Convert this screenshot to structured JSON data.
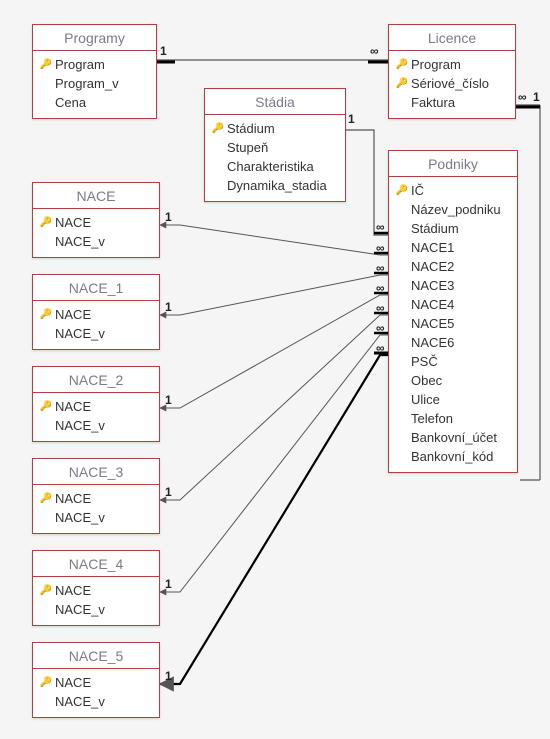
{
  "tables": {
    "programy": {
      "title": "Programy",
      "fields": [
        {
          "name": "Program",
          "pk": true
        },
        {
          "name": "Program_v",
          "pk": false
        },
        {
          "name": "Cena",
          "pk": false
        }
      ]
    },
    "licence": {
      "title": "Licence",
      "fields": [
        {
          "name": "Program",
          "pk": true
        },
        {
          "name": "Sériové_číslo",
          "pk": true
        },
        {
          "name": "Faktura",
          "pk": false
        }
      ]
    },
    "stadia": {
      "title": "Stádia",
      "fields": [
        {
          "name": "Stádium",
          "pk": true
        },
        {
          "name": "Stupeň",
          "pk": false
        },
        {
          "name": "Charakteristika",
          "pk": false
        },
        {
          "name": "Dynamika_stadia",
          "pk": false
        }
      ]
    },
    "podniky": {
      "title": "Podniky",
      "fields": [
        {
          "name": "IČ",
          "pk": true
        },
        {
          "name": "Název_podniku",
          "pk": false
        },
        {
          "name": "Stádium",
          "pk": false
        },
        {
          "name": "NACE1",
          "pk": false
        },
        {
          "name": "NACE2",
          "pk": false
        },
        {
          "name": "NACE3",
          "pk": false
        },
        {
          "name": "NACE4",
          "pk": false
        },
        {
          "name": "NACE5",
          "pk": false
        },
        {
          "name": "NACE6",
          "pk": false
        },
        {
          "name": "PSČ",
          "pk": false
        },
        {
          "name": "Obec",
          "pk": false
        },
        {
          "name": "Ulice",
          "pk": false
        },
        {
          "name": "Telefon",
          "pk": false
        },
        {
          "name": "Bankovní_účet",
          "pk": false
        },
        {
          "name": "Bankovní_kód",
          "pk": false
        }
      ]
    },
    "nace": {
      "title": "NACE",
      "fields": [
        {
          "name": "NACE",
          "pk": true
        },
        {
          "name": "NACE_v",
          "pk": false
        }
      ]
    },
    "nace_1": {
      "title": "NACE_1",
      "fields": [
        {
          "name": "NACE",
          "pk": true
        },
        {
          "name": "NACE_v",
          "pk": false
        }
      ]
    },
    "nace_2": {
      "title": "NACE_2",
      "fields": [
        {
          "name": "NACE",
          "pk": true
        },
        {
          "name": "NACE_v",
          "pk": false
        }
      ]
    },
    "nace_3": {
      "title": "NACE_3",
      "fields": [
        {
          "name": "NACE",
          "pk": true
        },
        {
          "name": "NACE_v",
          "pk": false
        }
      ]
    },
    "nace_4": {
      "title": "NACE_4",
      "fields": [
        {
          "name": "NACE",
          "pk": true
        },
        {
          "name": "NACE_v",
          "pk": false
        }
      ]
    },
    "nace_5": {
      "title": "NACE_5",
      "fields": [
        {
          "name": "NACE",
          "pk": true
        },
        {
          "name": "NACE_v",
          "pk": false
        }
      ]
    }
  },
  "cardinality": {
    "one": "1",
    "many": "∞"
  },
  "key_glyph": "🔑"
}
